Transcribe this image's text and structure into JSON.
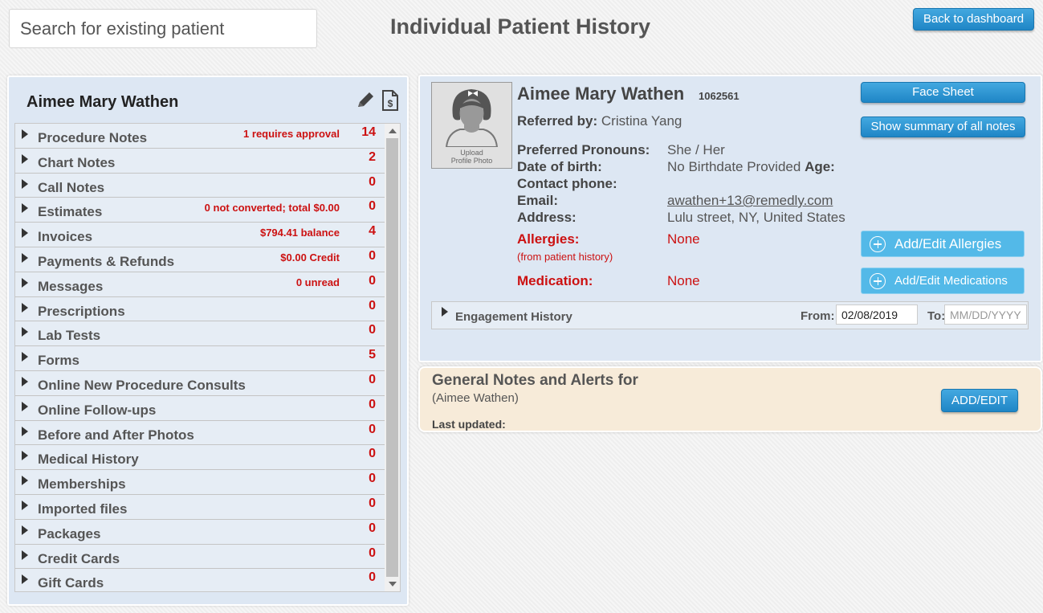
{
  "search": {
    "placeholder": "Search for existing patient"
  },
  "header": {
    "title": "Individual Patient History",
    "back_label": "Back to dashboard"
  },
  "left": {
    "patient_name": "Aimee Mary Wathen",
    "items": [
      {
        "label": "Procedure Notes",
        "note": "1 requires approval",
        "count": "14"
      },
      {
        "label": "Chart Notes",
        "note": "",
        "count": "2"
      },
      {
        "label": "Call Notes",
        "note": "",
        "count": "0"
      },
      {
        "label": "Estimates",
        "note": "0 not converted; total $0.00",
        "count": "0"
      },
      {
        "label": "Invoices",
        "note": "$794.41 balance",
        "count": "4"
      },
      {
        "label": "Payments & Refunds",
        "note": "$0.00 Credit",
        "count": "0"
      },
      {
        "label": "Messages",
        "note": "0 unread",
        "count": "0"
      },
      {
        "label": "Prescriptions",
        "note": "",
        "count": "0"
      },
      {
        "label": "Lab Tests",
        "note": "",
        "count": "0"
      },
      {
        "label": "Forms",
        "note": "",
        "count": "5"
      },
      {
        "label": "Online New Procedure Consults",
        "note": "",
        "count": "0"
      },
      {
        "label": "Online Follow-ups",
        "note": "",
        "count": "0"
      },
      {
        "label": "Before and After Photos",
        "note": "",
        "count": "0"
      },
      {
        "label": "Medical History",
        "note": "",
        "count": "0"
      },
      {
        "label": "Memberships",
        "note": "",
        "count": "0"
      },
      {
        "label": "Imported files",
        "note": "",
        "count": "0"
      },
      {
        "label": "Packages",
        "note": "",
        "count": "0"
      },
      {
        "label": "Credit Cards",
        "note": "",
        "count": "0"
      },
      {
        "label": "Gift Cards",
        "note": "",
        "count": "0"
      }
    ]
  },
  "patient": {
    "name": "Aimee Mary Wathen",
    "id": "1062561",
    "avatar_caption_1": "Upload",
    "avatar_caption_2": "Profile Photo",
    "referred_label": "Referred by:",
    "referred_value": "Cristina Yang",
    "pronouns_label": "Preferred Pronouns:",
    "pronouns_value": "She / Her",
    "dob_label": "Date of birth:",
    "dob_value": "No Birthdate Provided",
    "age_label": "Age:",
    "phone_label": "Contact phone:",
    "email_label": "Email:",
    "email_value": "awathen+13@remedly.com",
    "address_label": "Address:",
    "address_value": "Lulu street, NY, United States",
    "allergies_label": "Allergies:",
    "allergies_sub": "(from patient history)",
    "allergies_value": "None",
    "medication_label": "Medication:",
    "medication_value": "None",
    "face_sheet_label": "Face Sheet",
    "summary_label": "Show summary of all notes",
    "add_allergies_label": "Add/Edit Allergies",
    "add_medications_label": "Add/Edit Medications"
  },
  "engagement": {
    "label": "Engagement History",
    "from_label": "From:",
    "from_value": "02/08/2019",
    "to_label": "To:",
    "to_placeholder": "MM/DD/YYYY"
  },
  "notes": {
    "title": "General Notes and Alerts for",
    "subtitle": "(Aimee Wathen)",
    "last_updated": "Last updated:",
    "add_edit_label": "ADD/EDIT"
  }
}
